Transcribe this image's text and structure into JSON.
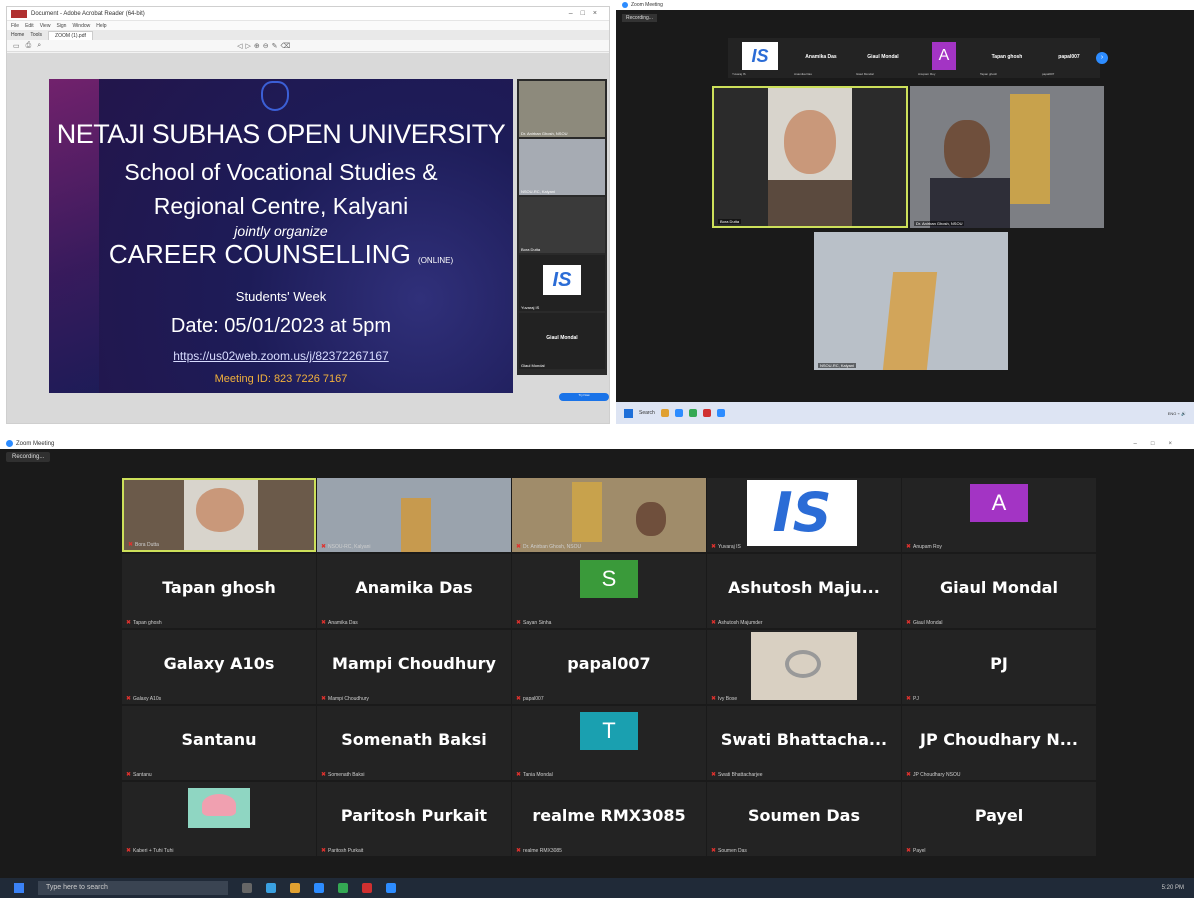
{
  "pdf_viewer": {
    "window_title": "Document - Adobe Acrobat Reader (64-bit)",
    "menu": [
      "File",
      "Edit",
      "View",
      "Sign",
      "Window",
      "Help"
    ],
    "tabs": [
      "Home",
      "Tools",
      "ZOOM (1).pdf"
    ],
    "slide": {
      "title": "NETAJI SUBHAS OPEN UNIVERSITY",
      "line2": "School of Vocational Studies &",
      "line3": "Regional Centre, Kalyani",
      "line4": "jointly organize",
      "line5": "CAREER COUNSELLING",
      "line5_suffix": "(ONLINE)",
      "line6": "Students' Week",
      "line7": "Date: 05/01/2023 at 5pm",
      "link": "https://us02web.zoom.us/j/82372267167",
      "meeting_id": "Meeting ID: 823 7226 7167"
    },
    "side_videos": [
      {
        "label": "Dr. Anirban Ghosh, NSOU"
      },
      {
        "label": "NSOU-RC, Kalyani"
      },
      {
        "label": "Bora Dutta"
      },
      {
        "label": "Yuvaraj IS"
      },
      {
        "label": "Giaul Mondal",
        "name": "Giaul Mondal"
      }
    ],
    "right_panel_button": "Try Now"
  },
  "zoom_small": {
    "window_title": "Zoom Meeting",
    "recording": "Recording...",
    "strip": [
      {
        "name": "",
        "sub": "Yuvaraj IS"
      },
      {
        "name": "Anamika Das",
        "sub": "Anamika Das"
      },
      {
        "name": "Giaul Mondal",
        "sub": "Giaul Mondal"
      },
      {
        "name": "A",
        "sub": "Anupam Roy"
      },
      {
        "name": "Tapan ghosh",
        "sub": "Tapan ghosh"
      },
      {
        "name": "papal007",
        "sub": "papal007"
      }
    ],
    "videos": [
      {
        "label": "Bora Dutta"
      },
      {
        "label": "Dr. Anirban Ghosh, NSOU"
      },
      {
        "label": "NSOU-RC, Kalyani"
      }
    ],
    "taskbar_search": "Search"
  },
  "zoom_main": {
    "window_title": "Zoom Meeting",
    "recording": "Recording...",
    "tiles": [
      {
        "type": "video",
        "sub": "Bora Dutta",
        "color": "#6b5a4a",
        "active": true
      },
      {
        "type": "video",
        "sub": "NSOU-RC, Kalyani",
        "color": "#9aa3ad"
      },
      {
        "type": "video",
        "sub": "Dr. Anirban Ghosh, NSOU",
        "color": "#a08c6a"
      },
      {
        "type": "logo",
        "sub": "Yuvaraj IS"
      },
      {
        "type": "letter",
        "letter": "A",
        "sub": "Anupam Roy",
        "color": "#a334c4"
      },
      {
        "type": "name",
        "name": "Tapan ghosh",
        "sub": "Tapan ghosh"
      },
      {
        "type": "name",
        "name": "Anamika Das",
        "sub": "Anamika Das"
      },
      {
        "type": "letter",
        "letter": "S",
        "sub": "Sayan Sinha",
        "color": "#3a9a3a"
      },
      {
        "type": "name",
        "name": "Ashutosh  Maju...",
        "sub": "Ashutosh Majumder"
      },
      {
        "type": "name",
        "name": "Giaul Mondal",
        "sub": "Giaul Mondal"
      },
      {
        "type": "name",
        "name": "Galaxy A10s",
        "sub": "Galaxy A10s"
      },
      {
        "type": "name",
        "name": "Mampi Choudhury",
        "sub": "Mampi Choudhury"
      },
      {
        "type": "name",
        "name": "papal007",
        "sub": "papal007"
      },
      {
        "type": "photo",
        "sub": "Ivy Bose",
        "color": "#d9d0c2"
      },
      {
        "type": "name",
        "name": "PJ",
        "sub": "PJ"
      },
      {
        "type": "name",
        "name": "Santanu",
        "sub": "Santanu"
      },
      {
        "type": "name",
        "name": "Somenath Baksi",
        "sub": "Somenath Baksi"
      },
      {
        "type": "letter",
        "letter": "T",
        "sub": "Tania Mondal",
        "color": "#1aa0b0"
      },
      {
        "type": "name",
        "name": "Swati  Bhattacha...",
        "sub": "Swati Bhattacharjee"
      },
      {
        "type": "name",
        "name": "JP Choudhary N...",
        "sub": "JP Choudhary NSOU"
      },
      {
        "type": "image",
        "sub": "Kaberi + Tuhi Tuhi",
        "color": "#8fd6c2"
      },
      {
        "type": "name",
        "name": "Paritosh Purkait",
        "sub": "Paritosh Purkait"
      },
      {
        "type": "name",
        "name": "realme RMX3085",
        "sub": "realme RMX3085"
      },
      {
        "type": "name",
        "name": "Soumen Das",
        "sub": "Soumen Das"
      },
      {
        "type": "name",
        "name": "Payel",
        "sub": "Payel"
      }
    ],
    "taskbar_search": "Type here to search",
    "clock": "5:20 PM"
  },
  "colors": {
    "zoom_bg": "#1a1a1a",
    "tile_bg": "#232323",
    "active_border": "#cde05a",
    "muted_red": "#e0322e",
    "zoom_blue": "#2d8cff"
  }
}
